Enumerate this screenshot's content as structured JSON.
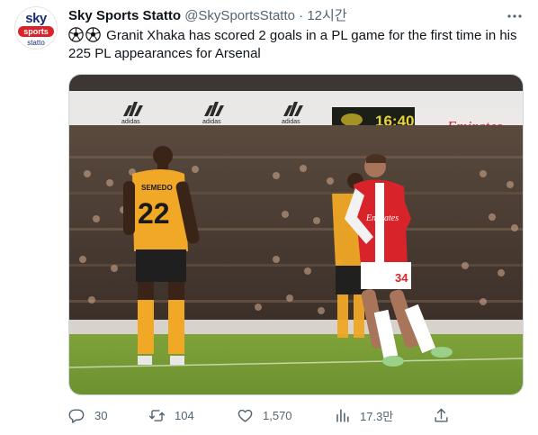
{
  "account": {
    "display_name": "Sky Sports Statto",
    "handle": "@SkySportsStatto",
    "separator": "·",
    "time": "12시간",
    "avatar": {
      "line1": "sky",
      "line2": "sports",
      "line3": "statto"
    }
  },
  "tweet": {
    "text": "Granit Xhaka has scored 2 goals in a PL game for the first time in his 225 PL appearances for Arsenal",
    "emoji": [
      "soccer-ball-icon",
      "soccer-ball-icon"
    ]
  },
  "media": {
    "board_text": [
      "adidas",
      "adidas",
      "adidas"
    ],
    "emirates_text": "Emirates",
    "clock_text": "16:40",
    "player_left": {
      "name": "SEMEDO",
      "number": "22"
    },
    "player_right": {
      "shirt": "Emirates",
      "number": "34"
    }
  },
  "actions": {
    "replies": "30",
    "retweets": "104",
    "likes": "1,570",
    "views": "17.3만"
  },
  "colors": {
    "text_primary": "#0f1419",
    "text_secondary": "#536471",
    "sky_red": "#d8232a",
    "sky_blue": "#1a2a78",
    "arsenal_red": "#d9232a",
    "wolves_gold": "#f0a826"
  }
}
